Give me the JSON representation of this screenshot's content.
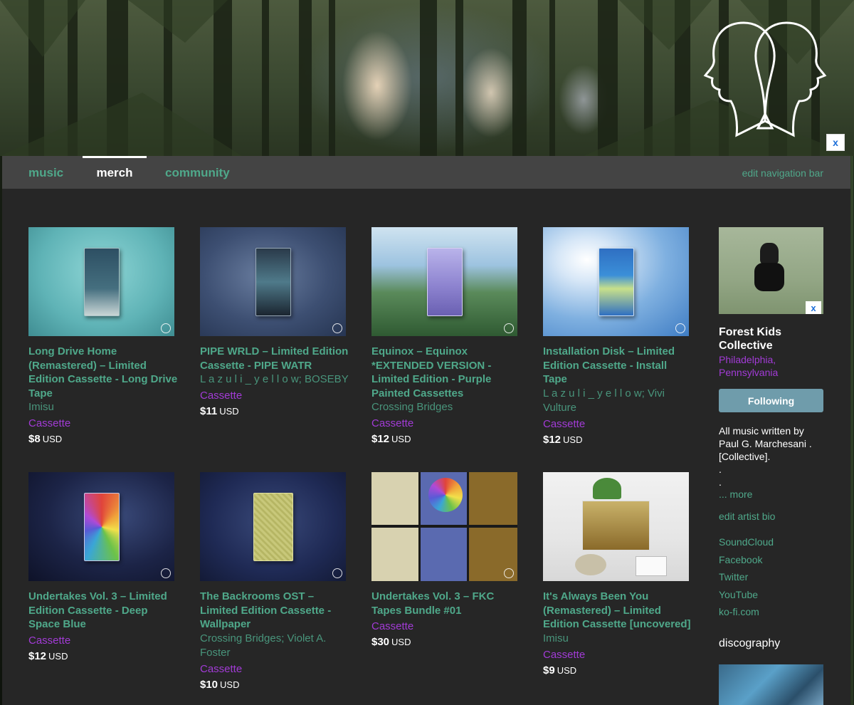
{
  "banner": {
    "close_label": "x"
  },
  "nav": {
    "tabs": [
      {
        "label": "music",
        "active": false
      },
      {
        "label": "merch",
        "active": true
      },
      {
        "label": "community",
        "active": false
      }
    ],
    "edit_label": "edit navigation bar"
  },
  "merch": [
    {
      "title": "Long Drive Home (Remastered) – Limited Edition Cassette - Long Drive Tape",
      "artist": "Imisu",
      "format": "Cassette",
      "price": "$8",
      "currency": "USD"
    },
    {
      "title": "PIPE WRLD – Limited Edition Cassette - PIPE WATR",
      "artist": "L a z u l i _ y e l l o w; BOSEBY",
      "format": "Cassette",
      "price": "$11",
      "currency": "USD"
    },
    {
      "title": "Equinox – Equinox *EXTENDED VERSION - Limited Edition - Purple Painted Cassettes",
      "artist": "Crossing Bridges",
      "format": "Cassette",
      "price": "$12",
      "currency": "USD"
    },
    {
      "title": "Installation Disk – Limited Edition Cassette - Install Tape",
      "artist": "L a z u l i _ y e l l o w; Vivi Vulture",
      "format": "Cassette",
      "price": "$12",
      "currency": "USD"
    },
    {
      "title": "Undertakes Vol. 3 – Limited Edition Cassette - Deep Space Blue",
      "artist": "",
      "format": "Cassette",
      "price": "$12",
      "currency": "USD"
    },
    {
      "title": "The Backrooms OST – Limited Edition Cassette - Wallpaper",
      "artist": "Crossing Bridges; Violet A. Foster",
      "format": "Cassette",
      "price": "$10",
      "currency": "USD"
    },
    {
      "title": "Undertakes Vol. 3 – FKC Tapes Bundle #01",
      "artist": "",
      "format": "Cassette",
      "price": "$30",
      "currency": "USD"
    },
    {
      "title": "It's Always Been You (Remastered) – Limited Edition Cassette [uncovered]",
      "artist": "Imisu",
      "format": "Cassette",
      "price": "$9",
      "currency": "USD"
    }
  ],
  "sidebar": {
    "close_label": "x",
    "band_name": "Forest Kids Collective",
    "location": "Philadelphia, Pennsylvania",
    "follow_label": "Following",
    "bio": "All music written by Paul G. Marchesani .[Collective].",
    "bio_dot": ".",
    "more_label": "... more",
    "edit_bio_label": "edit artist bio",
    "links": [
      "SoundCloud",
      "Facebook",
      "Twitter",
      "YouTube",
      "ko-fi.com"
    ],
    "discography_label": "discography"
  },
  "colors": {
    "link": "#4fa88a",
    "format": "#a23bd6",
    "panel": "#262626",
    "navbar": "#444444",
    "follow_button": "#6f9cab"
  }
}
